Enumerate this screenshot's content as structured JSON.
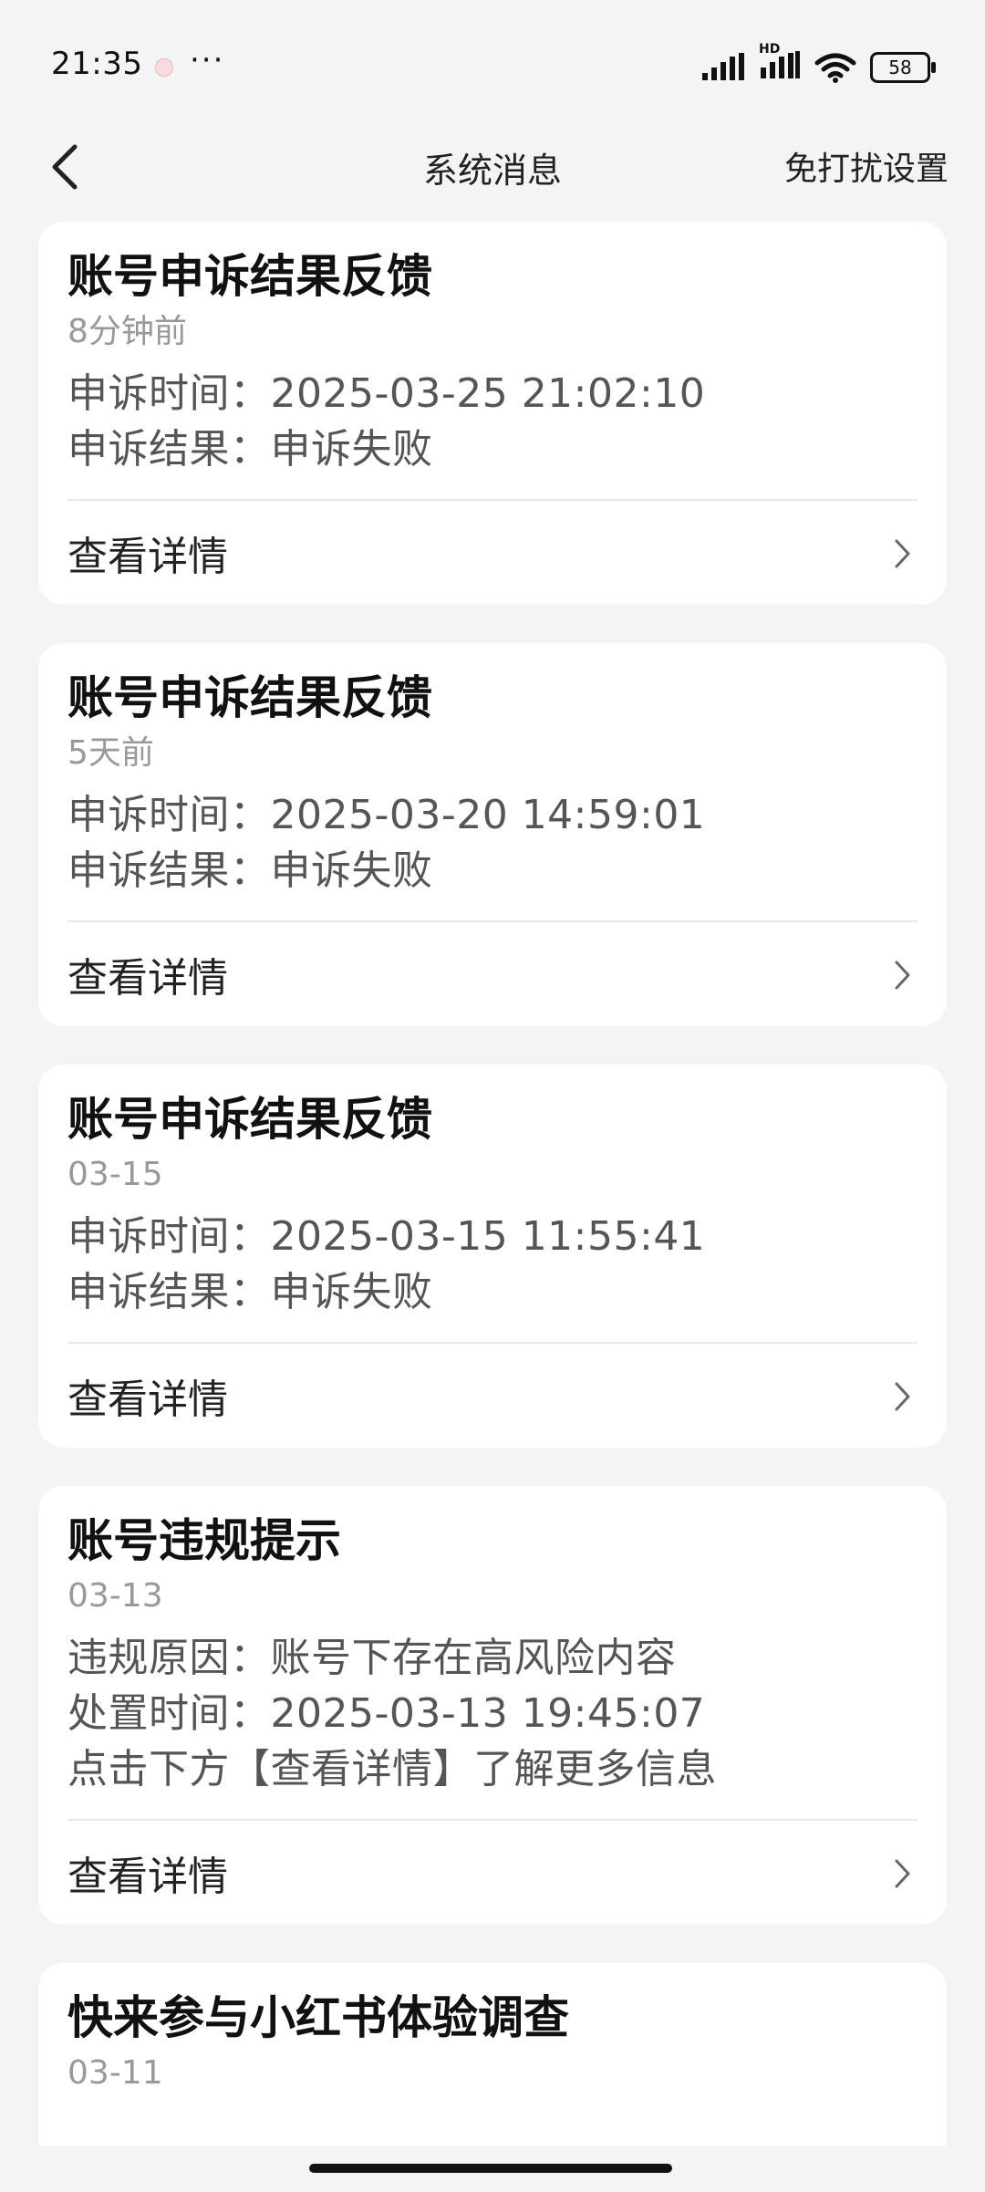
{
  "status_bar": {
    "time": "21:35",
    "more": "···",
    "battery": "58",
    "network_label": "HD"
  },
  "nav": {
    "title": "系统消息",
    "right_action": "免打扰设置"
  },
  "messages": [
    {
      "title": "账号申诉结果反馈",
      "time": "8分钟前",
      "lines": [
        "申诉时间：2025-03-25 21:02:10",
        "申诉结果：申诉失败"
      ],
      "action": "查看详情"
    },
    {
      "title": "账号申诉结果反馈",
      "time": "5天前",
      "lines": [
        "申诉时间：2025-03-20 14:59:01",
        "申诉结果：申诉失败"
      ],
      "action": "查看详情"
    },
    {
      "title": "账号申诉结果反馈",
      "time": "03-15",
      "lines": [
        "申诉时间：2025-03-15 11:55:41",
        "申诉结果：申诉失败"
      ],
      "action": "查看详情"
    },
    {
      "title": "账号违规提示",
      "time": "03-13",
      "lines": [
        "违规原因：账号下存在高风险内容",
        "处置时间：2025-03-13 19:45:07",
        "点击下方【查看详情】了解更多信息"
      ],
      "action": "查看详情"
    },
    {
      "title": "快来参与小红书体验调查",
      "time": "03-11"
    }
  ]
}
